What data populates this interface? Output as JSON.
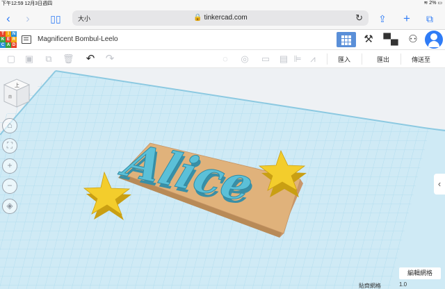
{
  "status_bar": {
    "time_date": "下午12:59  12月3日週四",
    "battery": "2%"
  },
  "browser": {
    "text_size": "大小",
    "url": "tinkercad.com"
  },
  "logo_letters": [
    "T",
    "I",
    "N",
    "K",
    "E",
    "R",
    "C",
    "A",
    "D"
  ],
  "logo_colors": [
    "#e8422a",
    "#f2a60c",
    "#2b8fd6",
    "#3aa444",
    "#e8422a",
    "#f2a60c",
    "#2b8fd6",
    "#3aa444",
    "#e8422a"
  ],
  "header": {
    "design_title": "Magnificent Bombul-Leelo"
  },
  "toolbar": {
    "import_label": "匯入",
    "export_label": "匯出",
    "send_to_label": "傳送至"
  },
  "viewcube": {
    "top_label": "上",
    "front_label": "前"
  },
  "scene": {
    "nameplate_text": "Alice"
  },
  "footer": {
    "edit_grid_label": "編輯網格",
    "snap_grid_label": "貼齊網格",
    "snap_grid_value": "1.0"
  },
  "colors": {
    "accent": "#2f7cf6",
    "text_3d": "#5bc0d8",
    "base_plate": "#e0b27b",
    "stars": "#f3cd2c",
    "grid_line": "#9fd4ea"
  }
}
